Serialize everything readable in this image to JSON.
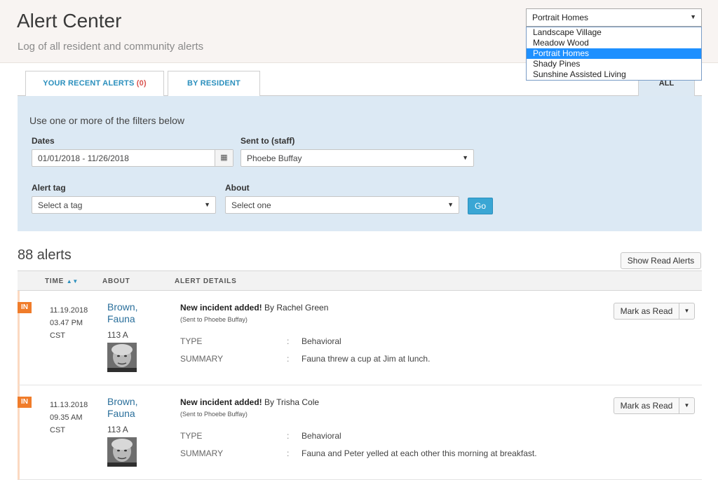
{
  "header": {
    "title": "Alert Center",
    "subtitle": "Log of all resident and community alerts"
  },
  "community": {
    "selected": "Portrait Homes",
    "options": [
      "Landscape Village",
      "Meadow Wood",
      "Portrait Homes",
      "Shady Pines",
      "Sunshine Assisted Living"
    ]
  },
  "tabs": {
    "recent_label": "YOUR RECENT ALERTS",
    "recent_count": "(0)",
    "by_resident": "BY RESIDENT",
    "all": "ALL"
  },
  "filters": {
    "intro": "Use one or more of the filters below",
    "dates_label": "Dates",
    "dates_value": "01/01/2018 - 11/26/2018",
    "sent_to_label": "Sent to (staff)",
    "sent_to_value": "Phoebe Buffay",
    "tag_label": "Alert tag",
    "tag_placeholder": "Select a tag",
    "about_label": "About",
    "about_placeholder": "Select one",
    "go_label": "Go"
  },
  "alerts": {
    "count_label": "88 alerts",
    "show_read_label": "Show Read Alerts",
    "columns": {
      "time": "TIME",
      "about": "ABOUT",
      "details": "ALERT DETAILS"
    },
    "mark_read_label": "Mark as Read",
    "items": [
      {
        "badge": "IN",
        "date": "11.19.2018",
        "time": "03.47 PM",
        "tz": "CST",
        "name_last": "Brown,",
        "name_first": "Fauna",
        "room": "113 A",
        "title": "New incident added!",
        "by": "By Rachel Green",
        "sent": "(Sent to Phoebe Buffay)",
        "type_key": "TYPE",
        "type_val": "Behavioral",
        "summary_key": "SUMMARY",
        "summary_val": "Fauna threw a cup at Jim at lunch."
      },
      {
        "badge": "IN",
        "date": "11.13.2018",
        "time": "09.35 AM",
        "tz": "CST",
        "name_last": "Brown,",
        "name_first": "Fauna",
        "room": "113 A",
        "title": "New incident added!",
        "by": "By Trisha Cole",
        "sent": "(Sent to Phoebe Buffay)",
        "type_key": "TYPE",
        "type_val": "Behavioral",
        "summary_key": "SUMMARY",
        "summary_val": "Fauna and Peter yelled at each other this morning at breakfast."
      }
    ]
  }
}
